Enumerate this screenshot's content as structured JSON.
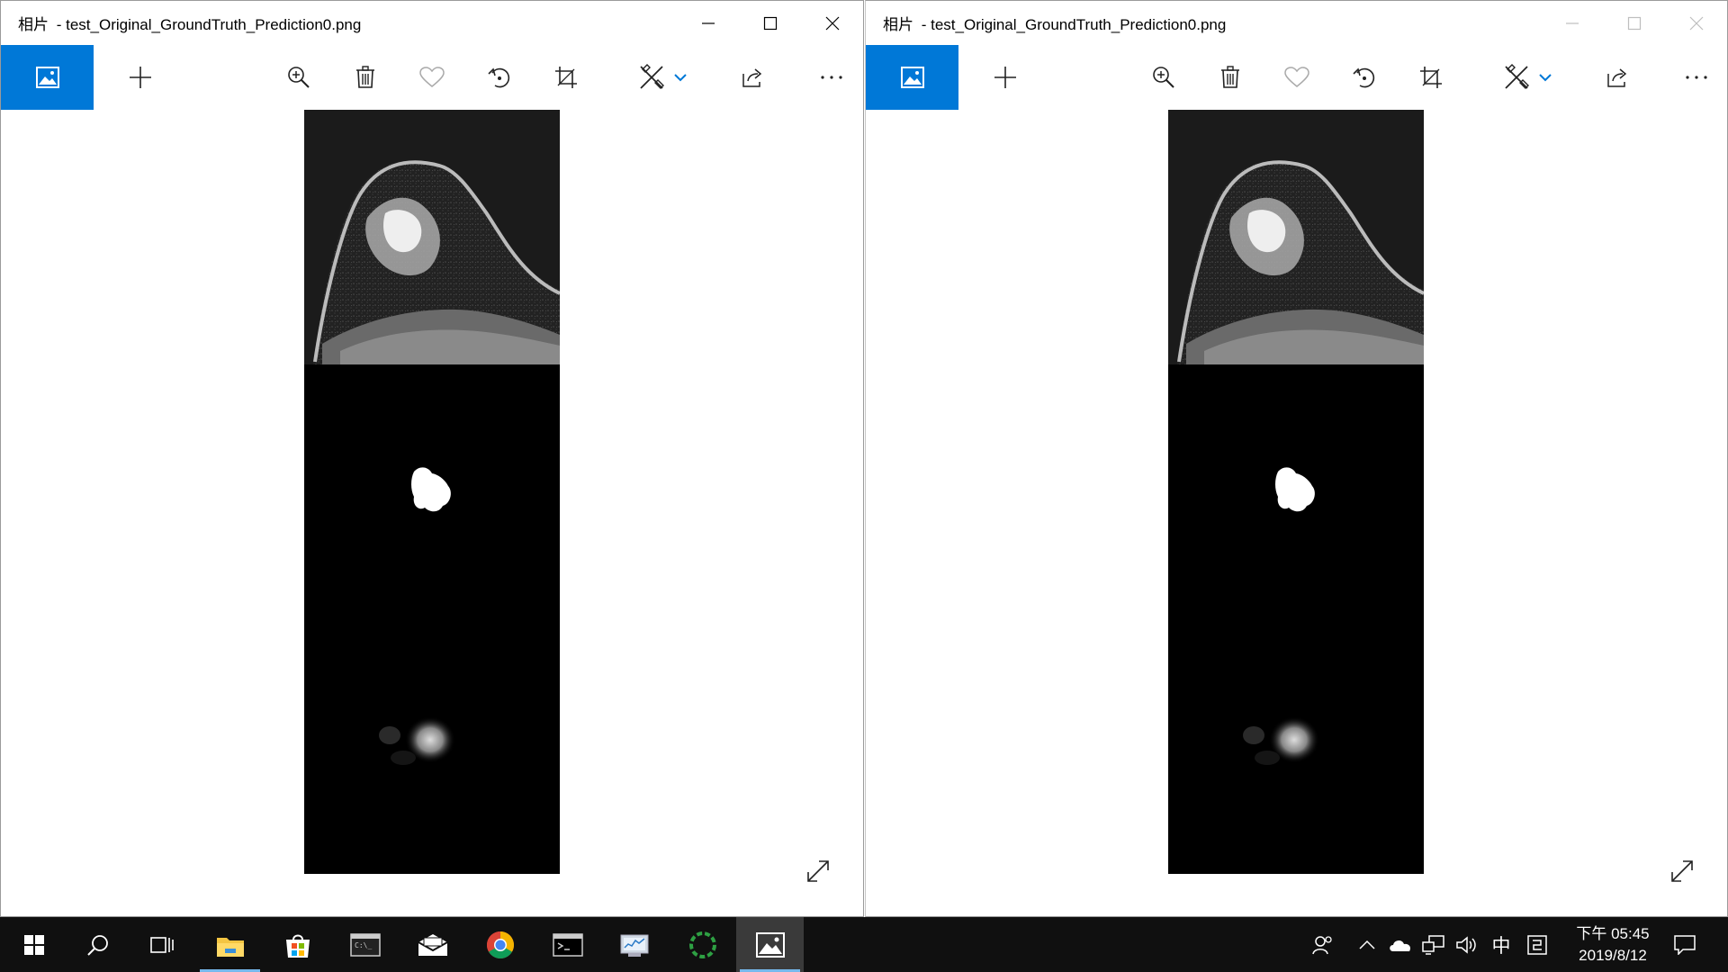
{
  "windows": [
    {
      "app_name": "相片",
      "separator": " - ",
      "file_name": "test_Original_GroundTruth_Prediction0.png",
      "active": true
    },
    {
      "app_name": "相片",
      "separator": " - ",
      "file_name": "test_Original_GroundTruth_Prediction0.png",
      "active": false
    }
  ],
  "toolbar_icons": [
    "photos-home-icon",
    "add-icon",
    "zoom-in-icon",
    "delete-icon",
    "favorite-heart-icon",
    "rotate-icon",
    "crop-icon",
    "edit-draw-icon",
    "chevron-down-icon",
    "share-icon",
    "more-icon"
  ],
  "taskbar": {
    "apps": [
      "windows-start-icon",
      "search-icon",
      "task-view-icon",
      "file-explorer-icon",
      "microsoft-store-icon",
      "command-prompt-icon",
      "mail-icon",
      "chrome-icon",
      "terminal-icon",
      "resource-monitor-icon",
      "loading-app-icon",
      "photos-icon"
    ],
    "tray": {
      "ime_label": "中",
      "time": "下午 05:45",
      "date": "2019/8/12"
    }
  },
  "colors": {
    "accent": "#0078d7",
    "taskbar": "#101010",
    "running_indicator": "#76b9ed"
  }
}
